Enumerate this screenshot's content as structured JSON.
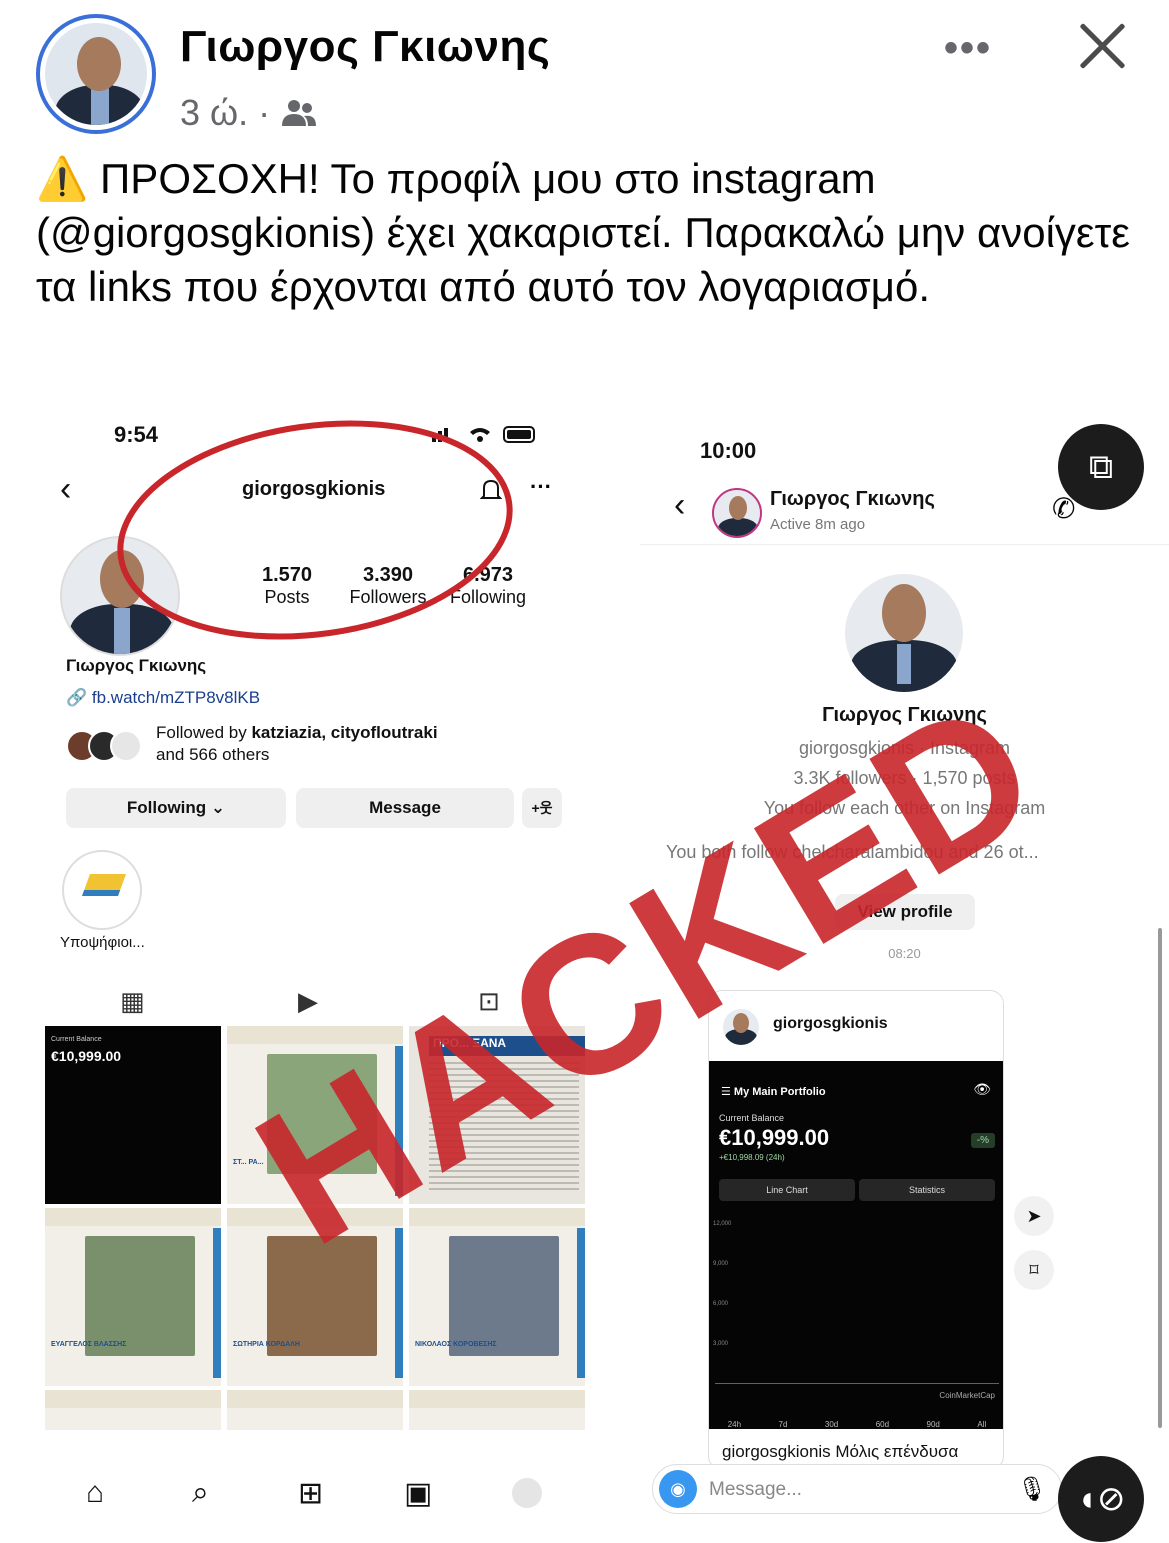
{
  "post": {
    "author": "Γιωργος Γκιωνης",
    "time": "3 ώ. ·",
    "audience_icon": "friends-icon",
    "more_icon": "more-dots-icon",
    "close_icon": "close-icon",
    "warning_emoji": "⚠️",
    "text": "ΠΡΟΣΟΧΗ! Το προφίλ μου στο instagram (@giorgosgkionis) έχει χακαριστεί. Παρακαλώ μην ανοίγετε τα links που έρχονται από αυτό τον λογαριασμό."
  },
  "instagram_profile": {
    "status_time": "9:54",
    "handle": "giorgosgkionis",
    "posts_count": "1.570",
    "posts_label": "Posts",
    "followers_count": "3.390",
    "followers_label": "Followers",
    "following_count": "6.973",
    "following_label": "Following",
    "name": "Γιωργος Γκιωνης",
    "link": "fb.watch/mZTP8v8lKB",
    "followed_by_prefix": "Followed by ",
    "followed_by_names": "katziazia, cityofloutraki",
    "followed_by_suffix": "and 566 others",
    "following_button": "Following ⌄",
    "message_button": "Message",
    "add_person_icon": "+웃",
    "highlight_label": "Υποψήφιοι...",
    "grid_cells": [
      {
        "type": "balance",
        "label": "Current Balance",
        "value": "€10,999.00"
      },
      {
        "type": "poster",
        "caption": "ΣΤ... ΡΑ..."
      },
      {
        "type": "news",
        "caption": "ΠΡΟ... ΞΑΝΑ"
      },
      {
        "type": "poster",
        "caption": "ΕΥΑΓΓΕΛΟΣ ΒΛΑΣΣΗΣ"
      },
      {
        "type": "poster",
        "caption": "ΣΩΤΗΡΙΑ ΚΟΡΔΑΛΗ"
      },
      {
        "type": "poster",
        "caption": "ΝΙΚΟΛΑΟΣ ΚΟΡΟΒΕΣΗΣ"
      }
    ]
  },
  "instagram_chat": {
    "status_time": "10:00",
    "contact_name": "Γιωργος Γκιωνης",
    "contact_status": "Active 8m ago",
    "profile_name": "Γιωργος Γκιωνης",
    "profile_handle": "giorgosgkionis · Instagram",
    "profile_followers": "3.3K followers · 1,570 posts",
    "profile_mutual": "You follow each other on Instagram",
    "profile_since": "You both follow chelcharalambidou and 26 ot...",
    "view_profile": "View profile",
    "message_time": "08:20",
    "shared_post_user": "giorgosgkionis",
    "portfolio_title": "My Main Portfolio",
    "balance_label": "Current Balance",
    "balance_value": "€10,999.00",
    "balance_change": "+€10,998.09 (24h)",
    "percent": "-%",
    "line_chart_tab": "Line Chart",
    "statistics_tab": "Statistics",
    "chart_ticks": [
      "12,000",
      "9,000",
      "6,000",
      "3,000"
    ],
    "range_tabs": [
      "24h",
      "7d",
      "30d",
      "60d",
      "90d",
      "All"
    ],
    "source": "CoinMarketCap",
    "caption": "giorgosgkionis Μόλις επένδυσα",
    "message_placeholder": "Message..."
  },
  "stamp": "HACKED"
}
